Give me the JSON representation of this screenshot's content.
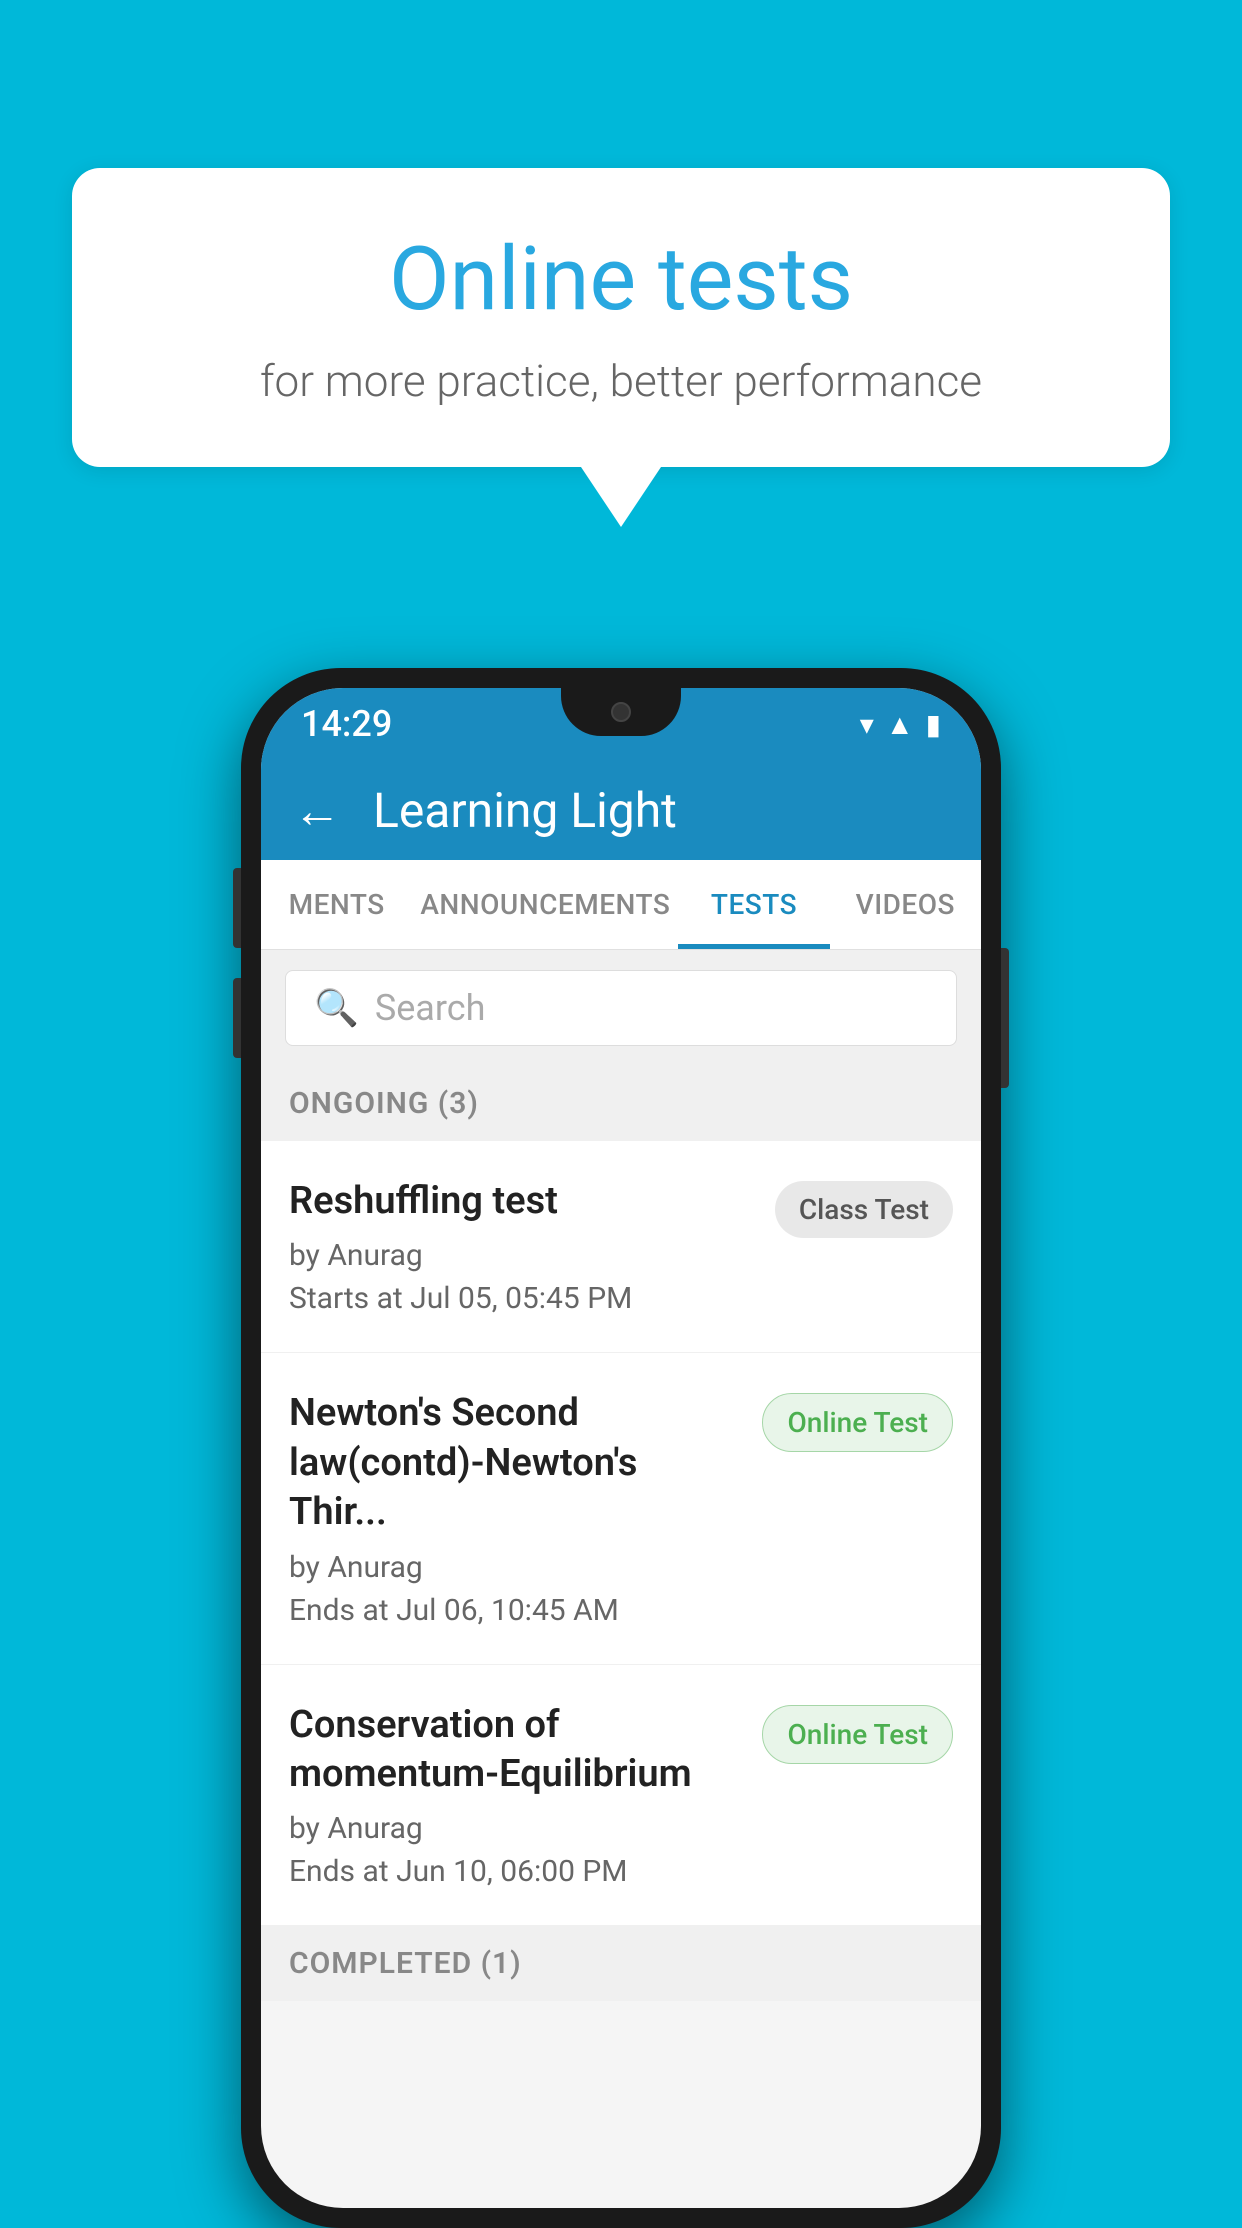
{
  "background": {
    "color": "#00b8d9"
  },
  "speech_bubble": {
    "title": "Online tests",
    "subtitle": "for more practice, better performance"
  },
  "phone": {
    "status_bar": {
      "time": "14:29",
      "icons": [
        "wifi",
        "signal",
        "battery"
      ]
    },
    "app_bar": {
      "title": "Learning Light",
      "back_label": "←"
    },
    "tabs": [
      {
        "label": "MENTS",
        "active": false
      },
      {
        "label": "ANNOUNCEMENTS",
        "active": false
      },
      {
        "label": "TESTS",
        "active": true
      },
      {
        "label": "VIDEOS",
        "active": false
      }
    ],
    "search": {
      "placeholder": "Search"
    },
    "ongoing_section": {
      "label": "ONGOING (3)"
    },
    "tests": [
      {
        "name": "Reshuffling test",
        "author": "by Anurag",
        "time_label": "Starts at",
        "time_value": "Jul 05, 05:45 PM",
        "badge": "Class Test",
        "badge_type": "class"
      },
      {
        "name": "Newton's Second law(contd)-Newton's Thir...",
        "author": "by Anurag",
        "time_label": "Ends at",
        "time_value": "Jul 06, 10:45 AM",
        "badge": "Online Test",
        "badge_type": "online"
      },
      {
        "name": "Conservation of momentum-Equilibrium",
        "author": "by Anurag",
        "time_label": "Ends at",
        "time_value": "Jun 10, 06:00 PM",
        "badge": "Online Test",
        "badge_type": "online"
      }
    ],
    "completed_section": {
      "label": "COMPLETED (1)"
    }
  }
}
